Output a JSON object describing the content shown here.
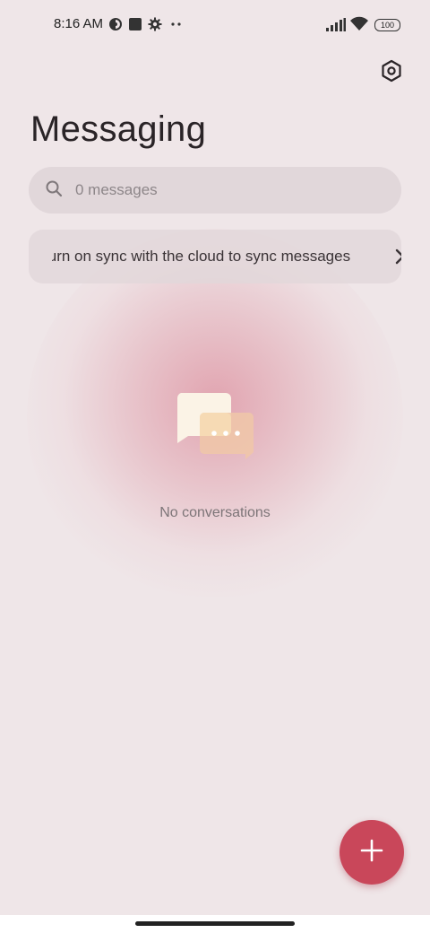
{
  "status_bar": {
    "time": "8:16 AM",
    "battery": "100",
    "icons": [
      "vpn-icon",
      "square-notification-icon",
      "gear-icon",
      "more-dots-icon",
      "signal-icon",
      "wifi-icon",
      "battery-icon"
    ]
  },
  "header": {
    "title": "Messaging",
    "settings_icon": "hex-settings-icon"
  },
  "search": {
    "placeholder": "0 messages",
    "value": "",
    "icon": "search-icon"
  },
  "sync_banner": {
    "text": "Turn on sync with the cloud to sync messages",
    "icon": "chevron-right-icon"
  },
  "empty_state": {
    "icon": "chat-bubbles-icon",
    "label": "No conversations"
  },
  "fab": {
    "icon": "plus-icon",
    "color": "#c9475a"
  },
  "colors": {
    "background": "#efe6e8",
    "accent": "#c9475a"
  }
}
